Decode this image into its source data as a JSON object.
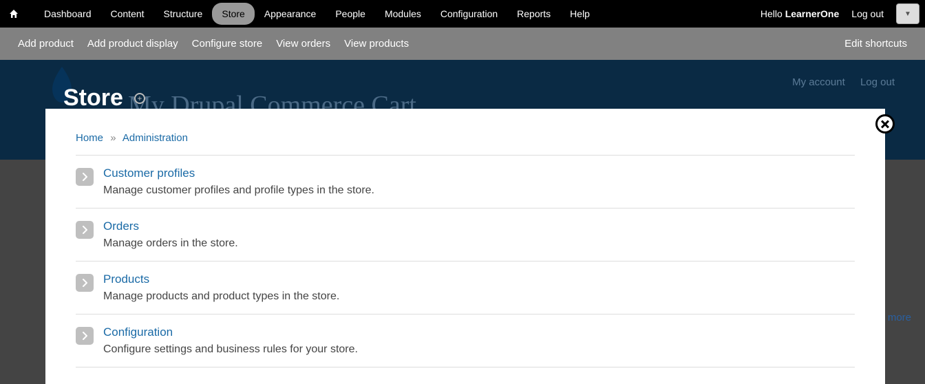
{
  "adminBar": {
    "items": [
      {
        "label": "Dashboard",
        "active": false
      },
      {
        "label": "Content",
        "active": false
      },
      {
        "label": "Structure",
        "active": false
      },
      {
        "label": "Store",
        "active": true
      },
      {
        "label": "Appearance",
        "active": false
      },
      {
        "label": "People",
        "active": false
      },
      {
        "label": "Modules",
        "active": false
      },
      {
        "label": "Configuration",
        "active": false
      },
      {
        "label": "Reports",
        "active": false
      },
      {
        "label": "Help",
        "active": false
      }
    ],
    "helloPrefix": "Hello ",
    "username": "LearnerOne",
    "logout": "Log out"
  },
  "shortcutBar": {
    "items": [
      "Add product",
      "Add product display",
      "Configure store",
      "View orders",
      "View products"
    ],
    "edit": "Edit shortcuts"
  },
  "region": {
    "pageTitle": "Store",
    "ghostTitle": "My Drupal Commerce Cart",
    "myAccount": "My account",
    "logout": "Log out",
    "ghostLink": "d more"
  },
  "overlay": {
    "breadcrumb": {
      "home": "Home",
      "sep": "»",
      "current": "Administration"
    },
    "items": [
      {
        "title": "Customer profiles",
        "desc": "Manage customer profiles and profile types in the store."
      },
      {
        "title": "Orders",
        "desc": "Manage orders in the store."
      },
      {
        "title": "Products",
        "desc": "Manage products and product types in the store."
      },
      {
        "title": "Configuration",
        "desc": "Configure settings and business rules for your store."
      }
    ]
  }
}
